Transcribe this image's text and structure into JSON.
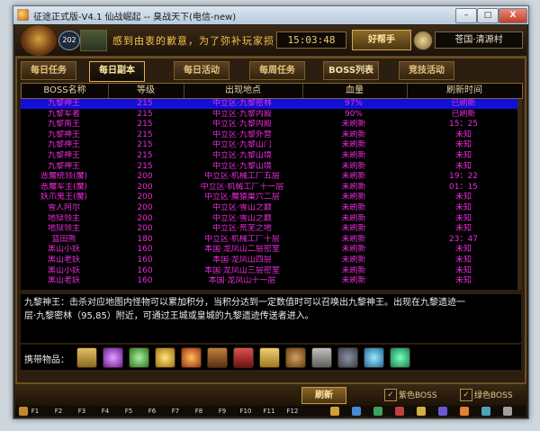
{
  "window": {
    "title": "征途正式版-V4.1 仙战崛起 -- 臭战天下(电信-new)",
    "controls": {
      "min": "–",
      "max": "□",
      "close": "X"
    }
  },
  "topbar": {
    "level": "202",
    "marquee": "感到由衷的歉意，为了弥补玩家损",
    "clock": "15:03:48",
    "helper_label": "好帮手",
    "location": "苍国·清源村"
  },
  "tabs": [
    {
      "label": "每日任务"
    },
    {
      "label": "每日副本"
    },
    {
      "label": "每日活动"
    },
    {
      "label": "每周任务"
    },
    {
      "label": "BOSS列表"
    },
    {
      "label": "竞技活动"
    }
  ],
  "table": {
    "headers": [
      "BOSS名称",
      "等级",
      "出现地点",
      "血量",
      "刷新时间"
    ],
    "rows": [
      [
        "九黎神王",
        "215",
        "中立区·九黎密林",
        "97%",
        "已刷新"
      ],
      [
        "九黎军者",
        "215",
        "中立区·九黎内殿",
        "90%",
        "已刷新"
      ],
      [
        "九黎南王",
        "215",
        "中立区·九黎内殿",
        "未刷新",
        "15：25"
      ],
      [
        "九黎神王",
        "215",
        "中立区·九黎外营",
        "未刷新",
        "未知"
      ],
      [
        "九黎神王",
        "215",
        "中立区·九黎山门",
        "未刷新",
        "未知"
      ],
      [
        "九黎神王",
        "215",
        "中立区·九黎山境",
        "未刷新",
        "未知"
      ],
      [
        "九黎神王",
        "215",
        "中立区·九黎山境",
        "未刷新",
        "未知"
      ],
      [
        "恶魔统领(魔)",
        "200",
        "中立区·机械工厂五层",
        "未刷新",
        "19：22"
      ],
      [
        "恶魔军主(魔)",
        "200",
        "中立区·机械工厂十一层",
        "未刷新",
        "01：15"
      ],
      [
        "妖爪鬼王(魔)",
        "200",
        "中立区·魔猿巢穴二层",
        "未刷新",
        "未知"
      ],
      [
        "雪人阿尔",
        "200",
        "中立区·雪山之巅",
        "未刷新",
        "未知"
      ],
      [
        "地狱领主",
        "200",
        "中立区·雪山之巅",
        "未刷新",
        "未知"
      ],
      [
        "地狱领主",
        "200",
        "中立区·荒芜之地",
        "未刷新",
        "未知"
      ],
      [
        "蓝田熊",
        "180",
        "中立区·机械工厂十层",
        "未刷新",
        "23：47"
      ],
      [
        "黑山小妖",
        "160",
        "本国·龙凤山二层密室",
        "未刷新",
        "未知"
      ],
      [
        "黑山老妖",
        "160",
        "本国·龙凤山四层",
        "未刷新",
        "未知"
      ],
      [
        "黑山小妖",
        "160",
        "本国·龙凤山三层密室",
        "未刷新",
        "未知"
      ],
      [
        "黑山老妖",
        "160",
        "本国·龙凤山十一层",
        "未刷新",
        "未知"
      ]
    ]
  },
  "description": {
    "line1": "九黎神王：击杀对应地图内怪物可以累加积分，当积分达到一定数值时可以召唤出九黎神王。出现在九黎遗迹一",
    "line2": "层·九黎密林（95,85）附近，可通过王城或皇城的九黎遗迹传送者进入。"
  },
  "carry": {
    "label": "携带物品：",
    "items": [
      "scroll-icon",
      "purple-gem-icon",
      "green-potion-icon",
      "gold-coin-icon",
      "fire-orb-icon",
      "treasure-chest-icon",
      "red-box-icon",
      "gold-scroll-icon",
      "pouch-icon",
      "gray-scroll-icon",
      "stone-icon",
      "crystal-icon",
      "emerald-icon"
    ]
  },
  "bottom": {
    "refresh_label": "刷新",
    "purple_boss_label": "紫色BOSS",
    "green_boss_label": "绿色BOSS"
  },
  "hotkeys": [
    "F1",
    "F2",
    "F3",
    "F4",
    "F5",
    "F6",
    "F7",
    "F8",
    "F9",
    "F10",
    "F11",
    "F12"
  ],
  "colors": {
    "row_text": "#ec2bdb",
    "selected_row": "#1210d8",
    "frame": "#6e4f22"
  }
}
